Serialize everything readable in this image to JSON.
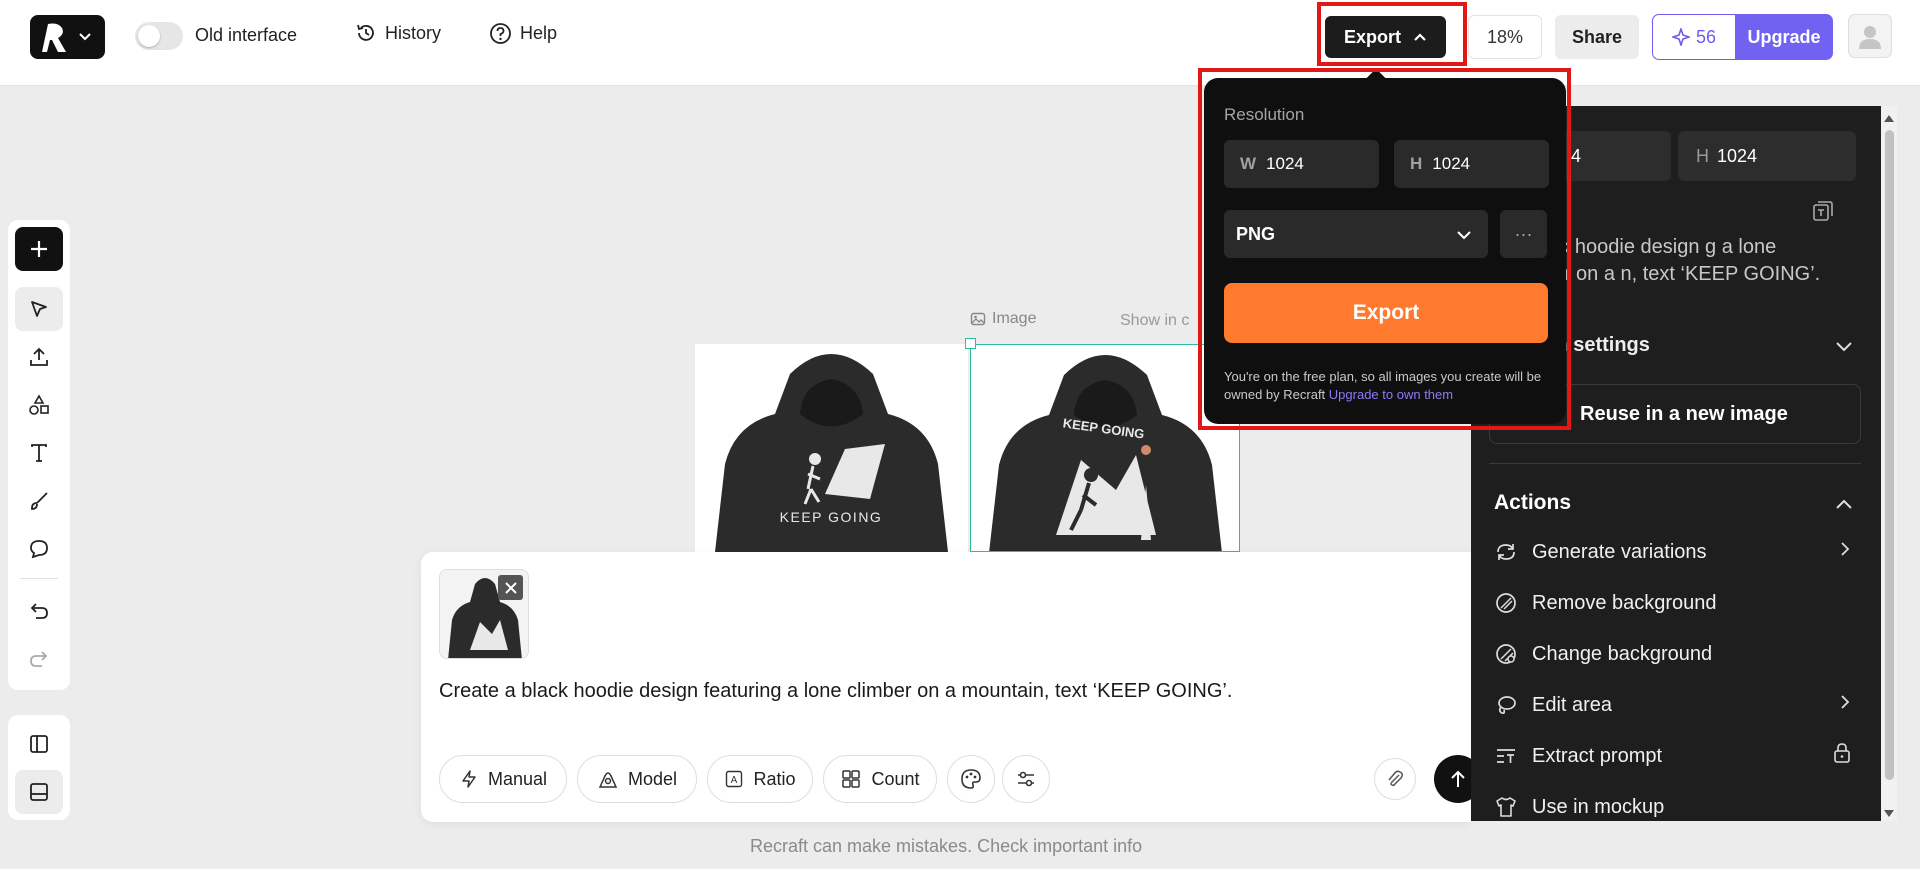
{
  "topbar": {
    "toggle_label": "Old interface",
    "history_label": "History",
    "help_label": "Help",
    "export_label": "Export",
    "zoom": "18%",
    "share_label": "Share",
    "credits": "56",
    "upgrade_label": "Upgrade"
  },
  "canvas": {
    "image_label": "Image",
    "show_in_label": "Show in c",
    "hoodie_text_1": "KEEP GOING",
    "hoodie_text_2": "KEEP GOING"
  },
  "export_popover": {
    "title": "Resolution",
    "width_key": "W",
    "width_value": "1024",
    "height_key": "H",
    "height_value": "1024",
    "format": "PNG",
    "more_label": "···",
    "export_button": "Export",
    "note": "You're on the free plan, so all images you create will be owned by Recraft",
    "note_link": "Upgrade to own them"
  },
  "right_panel": {
    "w_key": "",
    "w_value": "4",
    "h_key": "H",
    "h_value": "1024",
    "description": "a black hoodie design g a lone climber on a n, text ‘KEEP GOING’.",
    "settings_label": "tion settings",
    "reuse_label": "Reuse in a new image",
    "actions_title": "Actions",
    "actions": [
      {
        "label": "Generate variations",
        "icon": "refresh-icon"
      },
      {
        "label": "Remove background",
        "icon": "remove-bg-icon"
      },
      {
        "label": "Change background",
        "icon": "change-bg-icon"
      },
      {
        "label": "Edit area",
        "icon": "lasso-icon"
      },
      {
        "label": "Extract prompt",
        "icon": "extract-text-icon"
      },
      {
        "label": "Use in mockup",
        "icon": "shirt-icon"
      }
    ]
  },
  "prompt": {
    "text": "Create a black hoodie design featuring a lone climber on a mountain, text ‘KEEP GOING’.",
    "chips": {
      "manual": "Manual",
      "model": "Model",
      "ratio": "Ratio",
      "count": "Count"
    }
  },
  "disclaimer": "Recraft can make mistakes. Check important info",
  "colors": {
    "accent": "#7262f2",
    "export_orange": "#ff7a2e",
    "selection_teal": "#2bbfa0",
    "highlight_red": "#e01818"
  }
}
